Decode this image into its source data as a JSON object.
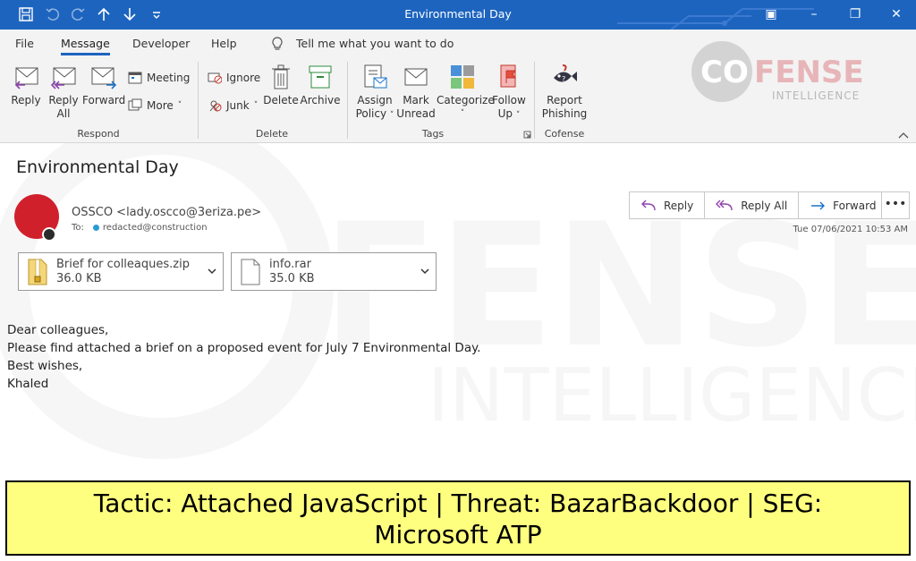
{
  "window": {
    "title": "Environmental Day"
  },
  "menu": {
    "items": [
      "File",
      "Message",
      "Developer",
      "Help"
    ],
    "tell_me": "Tell me what you want to do"
  },
  "ribbon": {
    "respond": {
      "reply": "Reply",
      "reply_all_1": "Reply",
      "reply_all_2": "All",
      "forward": "Forward",
      "meeting": "Meeting",
      "more": "More",
      "label": "Respond"
    },
    "delete": {
      "ignore": "Ignore",
      "junk": "Junk",
      "delete": "Delete",
      "archive": "Archive",
      "label": "Delete"
    },
    "tags": {
      "assign_1": "Assign",
      "assign_2": "Policy",
      "mark_1": "Mark",
      "mark_2": "Unread",
      "categorize": "Categorize",
      "follow_1": "Follow",
      "follow_2": "Up",
      "label": "Tags"
    },
    "cofense": {
      "report_1": "Report",
      "report_2": "Phishing",
      "label": "Cofense"
    }
  },
  "logo": {
    "part1": "CO",
    "part2": "FENSE",
    "sub": "INTELLIGENCE"
  },
  "message": {
    "subject": "Environmental Day",
    "sender": "OSSCO <lady.oscco@3eriza.pe>",
    "to_label": "To:",
    "to": "redacted@construction",
    "date": "Tue 07/06/2021 10:53 AM",
    "actions": {
      "reply": "Reply",
      "reply_all": "Reply All",
      "forward": "Forward"
    },
    "attachments": [
      {
        "name": "Brief for colleaques.zip",
        "size": "36.0 KB"
      },
      {
        "name": "info.rar",
        "size": "35.0 KB"
      }
    ],
    "body": [
      "Dear colleagues,",
      "Please find attached a brief on a proposed event for July 7 Environmental Day.",
      "Best wishes,",
      "Khaled"
    ]
  },
  "banner": {
    "line1": "Tactic: Attached JavaScript | Threat: BazarBackdoor | SEG:",
    "line2": "Microsoft ATP"
  },
  "colors": {
    "titlebar": "#1d64bf",
    "avatar": "#d0202c",
    "banner": "#ffff7f"
  }
}
